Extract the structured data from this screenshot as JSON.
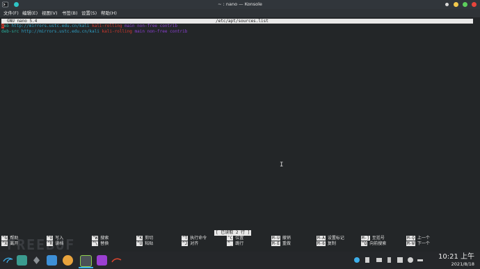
{
  "window": {
    "title": "~ : nano — Konsole"
  },
  "menu": [
    "文件(F)",
    "编辑(E)",
    "视图(V)",
    "书签(B)",
    "设置(S)",
    "帮助(H)"
  ],
  "nano": {
    "version": "GNU nano 5.4",
    "filename": "/etc/apt/sources.list",
    "status": "[ 已读取 2 行 ]"
  },
  "lines": [
    {
      "type": "deb",
      "url": "http://mirrors.ustc.edu.cn/kali",
      "suite": "kali-rolling",
      "comps": "main non-free contrib"
    },
    {
      "type": "deb-src",
      "url": "http://mirrors.ustc.edu.cn/kali",
      "suite": "kali-rolling",
      "comps": "main non-free contrib"
    }
  ],
  "shortcuts": [
    [
      {
        "key": "^G",
        "label": "帮助"
      },
      {
        "key": "^O",
        "label": "写入"
      },
      {
        "key": "^W",
        "label": "搜索"
      },
      {
        "key": "^K",
        "label": "剪切"
      },
      {
        "key": "^T",
        "label": "执行命令"
      },
      {
        "key": "^C",
        "label": "位置"
      },
      {
        "key": "M-U",
        "label": "撤销"
      },
      {
        "key": "M-A",
        "label": "设置标记"
      },
      {
        "key": "M-]",
        "label": "至括号"
      },
      {
        "key": "M-Q",
        "label": "上一个"
      }
    ],
    [
      {
        "key": "^X",
        "label": "离开"
      },
      {
        "key": "^R",
        "label": "读档"
      },
      {
        "key": "^\\",
        "label": "替换"
      },
      {
        "key": "^U",
        "label": "粘贴"
      },
      {
        "key": "^J",
        "label": "对齐"
      },
      {
        "key": "^_",
        "label": "跳行"
      },
      {
        "key": "M-E",
        "label": "重做"
      },
      {
        "key": "M-6",
        "label": "复制"
      },
      {
        "key": "^Q",
        "label": "向前搜索"
      },
      {
        "key": "M-W",
        "label": "下一个"
      }
    ]
  ],
  "taskbar": {
    "time": "10:21 上午",
    "date": "2021/8/18"
  },
  "watermark": "FREEBUF",
  "colors": {
    "titlebar": "#31363b",
    "terminal_bg": "#232628",
    "keyword_green": "#27b2a0",
    "url_blue": "#2ea3c9",
    "suite_red": "#d8392e",
    "component_purple": "#8a3fd1"
  }
}
